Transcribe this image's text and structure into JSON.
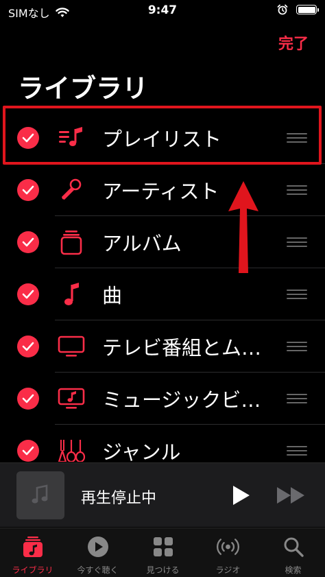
{
  "status_bar": {
    "carrier": "SIMなし",
    "time": "9:47"
  },
  "header": {
    "done_label": "完了",
    "title": "ライブラリ"
  },
  "library_items": [
    {
      "label": "プレイリスト",
      "icon": "playlist-icon",
      "checked": true
    },
    {
      "label": "アーティスト",
      "icon": "microphone-icon",
      "checked": true
    },
    {
      "label": "アルバム",
      "icon": "album-icon",
      "checked": true
    },
    {
      "label": "曲",
      "icon": "music-note-icon",
      "checked": true
    },
    {
      "label": "テレビ番組とム…",
      "icon": "tv-icon",
      "checked": true
    },
    {
      "label": "ミュージックビ…",
      "icon": "music-video-icon",
      "checked": true
    },
    {
      "label": "ジャンル",
      "icon": "genre-icon",
      "checked": true
    }
  ],
  "now_playing": {
    "title": "再生停止中"
  },
  "tabs": [
    {
      "label": "ライブラリ",
      "icon": "library-icon",
      "active": true
    },
    {
      "label": "今すぐ聴く",
      "icon": "listen-now-icon",
      "active": false
    },
    {
      "label": "見つける",
      "icon": "browse-icon",
      "active": false
    },
    {
      "label": "ラジオ",
      "icon": "radio-icon",
      "active": false
    },
    {
      "label": "検索",
      "icon": "search-icon",
      "active": false
    }
  ],
  "colors": {
    "accent": "#fa2d48",
    "annotation": "#e0151d",
    "background": "#000000"
  }
}
